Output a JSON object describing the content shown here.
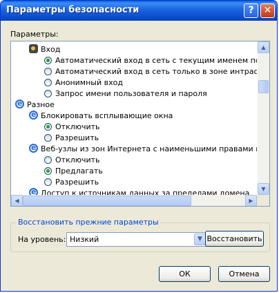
{
  "window": {
    "title": "Параметры безопасности",
    "help_glyph": "?",
    "close_glyph": "✕"
  },
  "params_label": "Параметры:",
  "tree": {
    "items": [
      {
        "kind": "header",
        "icon": "key-icon",
        "label": "Вход"
      },
      {
        "kind": "radio",
        "checked": true,
        "label": "Автоматический вход в сеть с текущим именем пользов"
      },
      {
        "kind": "radio",
        "checked": false,
        "label": "Автоматический вход в сеть только в зоне интрасети"
      },
      {
        "kind": "radio",
        "checked": false,
        "label": "Анонимный вход"
      },
      {
        "kind": "radio",
        "checked": false,
        "label": "Запрос имени пользователя и пароля"
      },
      {
        "kind": "category",
        "icon": "ie-icon",
        "label": "Разное"
      },
      {
        "kind": "setting",
        "icon": "ie-icon",
        "label": "Блокировать всплывающие окна"
      },
      {
        "kind": "radio",
        "checked": true,
        "label": "Отключить"
      },
      {
        "kind": "radio",
        "checked": false,
        "label": "Разрешить"
      },
      {
        "kind": "setting",
        "icon": "ie-icon",
        "label": "Веб-узлы из зон Интернета с наименьшими правами могут о"
      },
      {
        "kind": "radio",
        "checked": false,
        "label": "Отключить"
      },
      {
        "kind": "radio",
        "checked": true,
        "label": "Предлагать"
      },
      {
        "kind": "radio",
        "checked": false,
        "label": "Разрешить"
      },
      {
        "kind": "setting",
        "icon": "ie-icon",
        "label": "Доступ к источникам данных за пределами домена"
      }
    ]
  },
  "reset_group": {
    "legend": "Восстановить прежние параметры",
    "level_label": "На уровень:",
    "level_value": "Низкий",
    "restore_label": "Восстановить"
  },
  "buttons": {
    "ok": "ОК",
    "cancel": "Отмена"
  },
  "colors": {
    "title_bar": "#0a4fd0",
    "radio_dot": "#21a121",
    "group_legend": "#0046d5"
  }
}
